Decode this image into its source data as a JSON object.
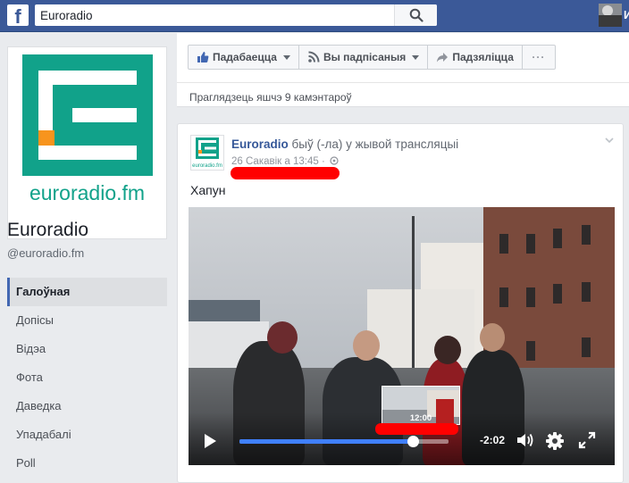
{
  "topbar": {
    "search_value": "Euroradio",
    "user_initial": "И"
  },
  "page": {
    "logo_text": "euroradio.fm",
    "name": "Euroradio",
    "handle": "@euroradio.fm",
    "nav": [
      {
        "label": "Галоўная",
        "active": true
      },
      {
        "label": "Допісы"
      },
      {
        "label": "Відэа"
      },
      {
        "label": "Фота"
      },
      {
        "label": "Даведка"
      },
      {
        "label": "Упадабалі"
      },
      {
        "label": "Poll"
      }
    ]
  },
  "toolbar": {
    "like_label": "Падабаецца",
    "follow_label": "Вы падпісаныя",
    "share_label": "Падзяліцца",
    "more_label": "···"
  },
  "comments_link": "Праглядзець яшчэ 9 камэнтароў",
  "post": {
    "author": "Euroradio",
    "action": " быў (-ла) у жывой трансляцыі",
    "time": "26 Сакавік а 13:45 ·",
    "text": "Хапун",
    "avatar_text": "euroradio.fm",
    "video": {
      "preview_time": "12:00",
      "time_left": "-2:02",
      "progress": 0.83
    }
  },
  "colors": {
    "facebook_blue": "#3b5998",
    "brand_green": "#11a28a",
    "brand_orange": "#f7941d",
    "redaction": "#ff0000",
    "progress": "#4080ff"
  }
}
